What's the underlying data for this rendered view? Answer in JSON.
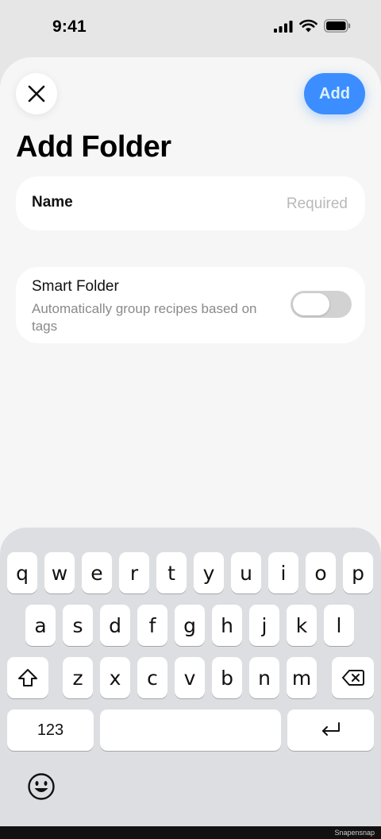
{
  "status_bar": {
    "time": "9:41"
  },
  "header": {
    "add_label": "Add",
    "title": "Add Folder"
  },
  "name_field": {
    "label": "Name",
    "placeholder": "Required",
    "value": ""
  },
  "smart_folder": {
    "title": "Smart Folder",
    "description": "Automatically group recipes based on tags",
    "enabled": false
  },
  "keyboard": {
    "row1": [
      "q",
      "w",
      "e",
      "r",
      "t",
      "y",
      "u",
      "i",
      "o",
      "p"
    ],
    "row2": [
      "a",
      "s",
      "d",
      "f",
      "g",
      "h",
      "j",
      "k",
      "l"
    ],
    "row3": [
      "z",
      "x",
      "c",
      "v",
      "b",
      "n",
      "m"
    ],
    "numbers_label": "123",
    "space_label": "",
    "icons": {
      "shift": "shift-icon",
      "backspace": "backspace-icon",
      "return": "return-icon",
      "emoji": "emoji-icon"
    }
  },
  "watermark": "Snapensnap",
  "colors": {
    "accent": "#3c8dff",
    "sheet": "#f5f6f5",
    "keyboard": "#dddee2"
  }
}
